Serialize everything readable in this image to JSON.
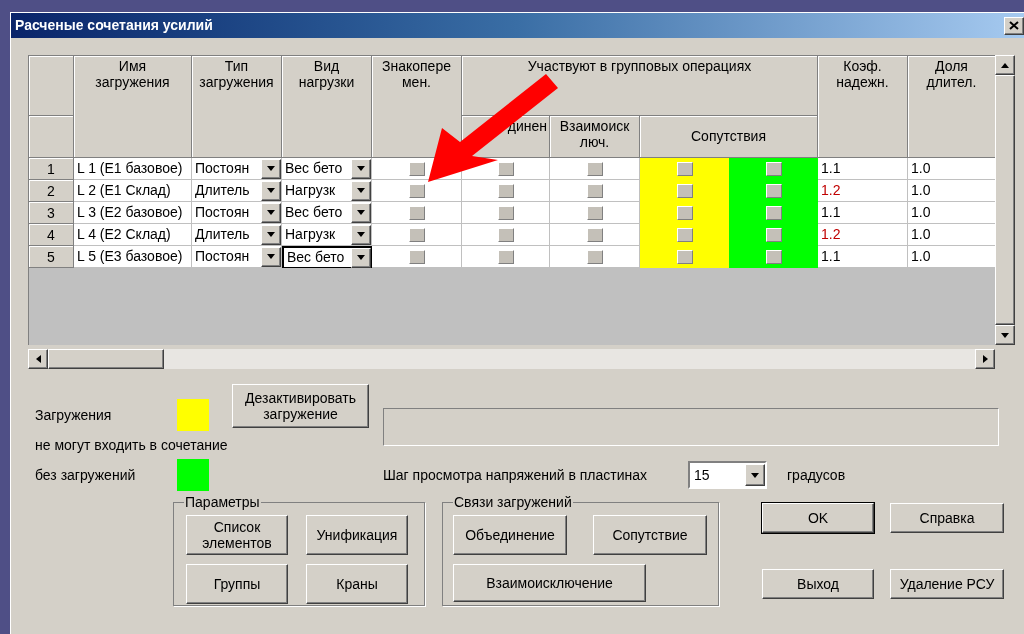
{
  "window": {
    "title": "Расченые сочетания усилий"
  },
  "table": {
    "headers": {
      "name": "Имя\nзагружения",
      "load_type": "Тип\nзагружения",
      "load_kind": "Вид\nнагрузки",
      "sign_change": "Знакопере\nмен.",
      "group_ops": "Участвуют в групповых операциях",
      "union": "динен",
      "mutual_exclusion": "Взаимоиск\nлюч.",
      "accompany": "Сопутствия",
      "coef": "Коэф.\nнадежн.",
      "share": "Доля\nдлител."
    },
    "accompany_columns": [
      {
        "color": "#ffff00"
      },
      {
        "color": "#00ff00"
      }
    ],
    "rows": [
      {
        "number": "1",
        "name": "L 1 (E1 базовое)",
        "load_type": "Постоян",
        "load_kind": "Вес бето",
        "focused": false,
        "sign_change": false,
        "union": false,
        "mutual_exclusion": false,
        "accompany": [
          false,
          false
        ],
        "coef": "1.1",
        "coef_highlighted": false,
        "share": "1.0"
      },
      {
        "number": "2",
        "name": "L 2 (E1 Склад)",
        "load_type": "Длитель",
        "load_kind": "Нагрузк",
        "focused": false,
        "sign_change": false,
        "union": false,
        "mutual_exclusion": false,
        "accompany": [
          false,
          false
        ],
        "coef": "1.2",
        "coef_highlighted": true,
        "share": "1.0"
      },
      {
        "number": "3",
        "name": "L 3 (E2 базовое)",
        "load_type": "Постоян",
        "load_kind": "Вес бето",
        "focused": false,
        "sign_change": false,
        "union": false,
        "mutual_exclusion": false,
        "accompany": [
          false,
          false
        ],
        "coef": "1.1",
        "coef_highlighted": false,
        "share": "1.0"
      },
      {
        "number": "4",
        "name": "L 4 (E2 Склад)",
        "load_type": "Длитель",
        "load_kind": "Нагрузк",
        "focused": false,
        "sign_change": false,
        "union": false,
        "mutual_exclusion": false,
        "accompany": [
          false,
          false
        ],
        "coef": "1.2",
        "coef_highlighted": true,
        "share": "1.0"
      },
      {
        "number": "5",
        "name": "L 5 (E3 базовое)",
        "load_type": "Постоян",
        "load_kind": "Вес бето",
        "focused": true,
        "sign_change": false,
        "union": false,
        "mutual_exclusion": false,
        "accompany": [
          false,
          false
        ],
        "coef": "1.1",
        "coef_highlighted": false,
        "share": "1.0"
      }
    ]
  },
  "legend": [
    {
      "label": "Загружения",
      "color": "#ffff00"
    },
    {
      "label": "не могут входить в сочетание"
    },
    {
      "label": "без загружений",
      "color": "#00ff00"
    }
  ],
  "deactivate_button": "Дезактивировать\nзагружение",
  "step": {
    "label": "Шаг просмотра напряжений в пластинах",
    "value": "15",
    "unit": "градусов"
  },
  "parameters": {
    "title": "Параметры",
    "buttons": [
      "Список\nэлементов",
      "Унификация",
      "Группы",
      "Краны"
    ]
  },
  "links": {
    "title": "Связи загружений",
    "buttons": [
      "Объединение",
      "Сопутствие",
      "Взаимоисключение"
    ]
  },
  "actions": [
    {
      "label": "OK",
      "default": true
    },
    {
      "label": "Справка",
      "default": false
    },
    {
      "label": "Выход",
      "default": false
    },
    {
      "label": "Удаление РСУ",
      "default": false
    }
  ]
}
